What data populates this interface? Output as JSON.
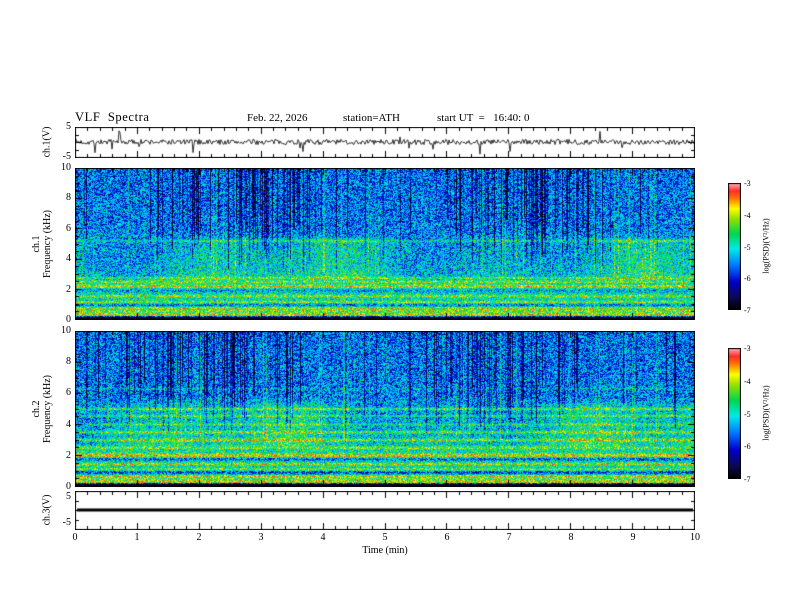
{
  "header": {
    "title": "VLF  Spectra",
    "date": "Feb. 22, 2026",
    "station": "station=ATH",
    "start_ut": "start UT  =   16:40: 0"
  },
  "axes": {
    "xlabel": "Time  (min)",
    "time_tick_labels": [
      "0",
      "1",
      "2",
      "3",
      "4",
      "5",
      "6",
      "7",
      "8",
      "9",
      "10"
    ],
    "time_range_min": [
      0,
      10
    ]
  },
  "colorbar": {
    "label": "log(PSD)(V²/Hz)",
    "tick_labels": [
      "-3",
      "-4",
      "-5",
      "-6",
      "-7"
    ],
    "value_range": [
      -7,
      -3
    ],
    "colormap_stops": [
      {
        "v": 0.0,
        "rgb": [
          0,
          0,
          0
        ]
      },
      {
        "v": 0.1,
        "rgb": [
          12,
          10,
          86
        ]
      },
      {
        "v": 0.22,
        "rgb": [
          0,
          0,
          205
        ]
      },
      {
        "v": 0.35,
        "rgb": [
          0,
          120,
          255
        ]
      },
      {
        "v": 0.48,
        "rgb": [
          0,
          235,
          235
        ]
      },
      {
        "v": 0.6,
        "rgb": [
          0,
          215,
          80
        ]
      },
      {
        "v": 0.72,
        "rgb": [
          150,
          225,
          0
        ]
      },
      {
        "v": 0.8,
        "rgb": [
          255,
          255,
          0
        ]
      },
      {
        "v": 0.88,
        "rgb": [
          255,
          120,
          0
        ]
      },
      {
        "v": 0.94,
        "rgb": [
          255,
          45,
          45
        ]
      },
      {
        "v": 1.0,
        "rgb": [
          255,
          175,
          175
        ]
      }
    ]
  },
  "chart_data": [
    {
      "type": "line",
      "panel": "ch1-waveform",
      "ylabel_lines": [
        "ch.1(V)"
      ],
      "ytick_labels": [
        "5",
        "-5"
      ],
      "ylim": [
        -5,
        5
      ],
      "xlim": [
        0,
        10
      ],
      "summary": "Broadband receiver noise fluctuating within roughly ±1.5 V with sporadic impulsive spikes (sferics) reaching about ±4 V across the full 10-minute record.",
      "gen": {
        "seed": 7,
        "noise_amp": 0.9,
        "spike_prob": 0.03,
        "spike_amp": 4.2
      }
    },
    {
      "type": "heatmap",
      "panel": "ch1-spectrogram",
      "ylabel_lines": [
        "ch.1",
        "Frequency (kHz)"
      ],
      "ylim": [
        0,
        10
      ],
      "yticks": [
        0,
        2,
        4,
        6,
        8,
        10
      ],
      "xlim": [
        0,
        10
      ],
      "value_range": [
        -7,
        -3
      ],
      "value_label": "log(PSD)(V²/Hz)",
      "summary": "0–10 kHz VLF spectrogram: dark-blue vertical sferic streaks above ~5 kHz over a blue background, cyan–green diffuse noise between ~2.5 and 5 kHz, quasi-continuous green/yellow emission lines near 2.75, 2.5, 2.2, 1.55, 1.15, 0.75, 0.55 and 0.35 kHz, a cyan line near 5.2 kHz, and a black band below ~0.2 kHz. log(PSD) spans -7 (black) to -3 (pink/red).",
      "gen": {
        "seed": 42,
        "noise_amp": 0.2,
        "base_profile": [
          [
            0,
            0.03
          ],
          [
            0.16,
            0.03
          ],
          [
            0.24,
            0.52
          ],
          [
            2.5,
            0.54
          ],
          [
            3.2,
            0.47
          ],
          [
            5.2,
            0.43
          ],
          [
            5.8,
            0.35
          ],
          [
            10,
            0.33
          ]
        ],
        "streaks": {
          "prob": 0.42,
          "depth_min": 0.12,
          "depth_max": 0.38,
          "floor_min": 3.2,
          "floor_max": 6.8
        },
        "lines": [
          {
            "f": 5.2,
            "a": 0.14,
            "w": 0.06
          },
          {
            "f": 2.75,
            "a": 0.16,
            "w": 0.05
          },
          {
            "f": 2.5,
            "a": 0.2,
            "w": 0.05
          },
          {
            "f": 2.2,
            "a": 0.24,
            "w": 0.06
          },
          {
            "f": 1.9,
            "a": -0.12,
            "w": 0.08
          },
          {
            "f": 1.55,
            "a": 0.18,
            "w": 0.05
          },
          {
            "f": 1.15,
            "a": 0.16,
            "w": 0.05
          },
          {
            "f": 0.95,
            "a": -0.18,
            "w": 0.06
          },
          {
            "f": 0.75,
            "a": 0.22,
            "w": 0.05
          },
          {
            "f": 0.55,
            "a": 0.26,
            "w": 0.05
          },
          {
            "f": 0.35,
            "a": 0.28,
            "w": 0.06
          }
        ],
        "black_band": [
          0,
          0.16
        ]
      }
    },
    {
      "type": "heatmap",
      "panel": "ch2-spectrogram",
      "ylabel_lines": [
        "ch.2",
        "Frequency (kHz)"
      ],
      "ylim": [
        0,
        10
      ],
      "yticks": [
        0,
        2,
        4,
        6,
        8,
        10
      ],
      "xlim": [
        0,
        10
      ],
      "value_range": [
        -7,
        -3
      ],
      "value_label": "log(PSD)(V²/Hz)",
      "summary": "0–10 kHz VLF spectrogram for channel 2: same sferic streak structure above ~5 kHz, but with stronger yellow hum/emission lines near 5.0, 4.55, 4.0, 3.5, 3.0, 2.5, 2.0, 1.45, 1.1, 0.65, 0.45 and 0.3 kHz, dark bands near 1.75 and 0.9 kHz, and a black band below ~0.2 kHz.",
      "gen": {
        "seed": 1337,
        "noise_amp": 0.2,
        "base_profile": [
          [
            0,
            0.03
          ],
          [
            0.16,
            0.03
          ],
          [
            0.24,
            0.52
          ],
          [
            2.5,
            0.54
          ],
          [
            3.2,
            0.48
          ],
          [
            5.2,
            0.44
          ],
          [
            5.8,
            0.35
          ],
          [
            10,
            0.33
          ]
        ],
        "streaks": {
          "prob": 0.4,
          "depth_min": 0.12,
          "depth_max": 0.36,
          "floor_min": 3.4,
          "floor_max": 6.8
        },
        "lines": [
          {
            "f": 6.3,
            "a": 0.1,
            "w": 0.05
          },
          {
            "f": 5.0,
            "a": 0.2,
            "w": 0.06
          },
          {
            "f": 4.55,
            "a": 0.16,
            "w": 0.05
          },
          {
            "f": 4.0,
            "a": 0.14,
            "w": 0.05
          },
          {
            "f": 3.5,
            "a": 0.2,
            "w": 0.06
          },
          {
            "f": 3.0,
            "a": 0.24,
            "w": 0.06
          },
          {
            "f": 2.5,
            "a": 0.18,
            "w": 0.05
          },
          {
            "f": 2.0,
            "a": 0.32,
            "w": 0.07
          },
          {
            "f": 1.75,
            "a": -0.22,
            "w": 0.07
          },
          {
            "f": 1.45,
            "a": 0.24,
            "w": 0.05
          },
          {
            "f": 1.1,
            "a": 0.18,
            "w": 0.05
          },
          {
            "f": 0.9,
            "a": -0.26,
            "w": 0.07
          },
          {
            "f": 0.65,
            "a": 0.28,
            "w": 0.05
          },
          {
            "f": 0.45,
            "a": 0.26,
            "w": 0.05
          },
          {
            "f": 0.3,
            "a": 0.3,
            "w": 0.05
          }
        ],
        "black_band": [
          0,
          0.16
        ]
      }
    },
    {
      "type": "line",
      "panel": "ch3-waveform",
      "ylabel_lines": [
        "ch.3(V)"
      ],
      "ytick_labels": [
        "5",
        "-5"
      ],
      "ylim": [
        -5,
        5
      ],
      "xlim": [
        0,
        10
      ],
      "constant_value": 0,
      "summary": "Flat trace pinned at 0 V for the entire 10 minutes (channel inactive), drawn as a thick black line."
    }
  ]
}
